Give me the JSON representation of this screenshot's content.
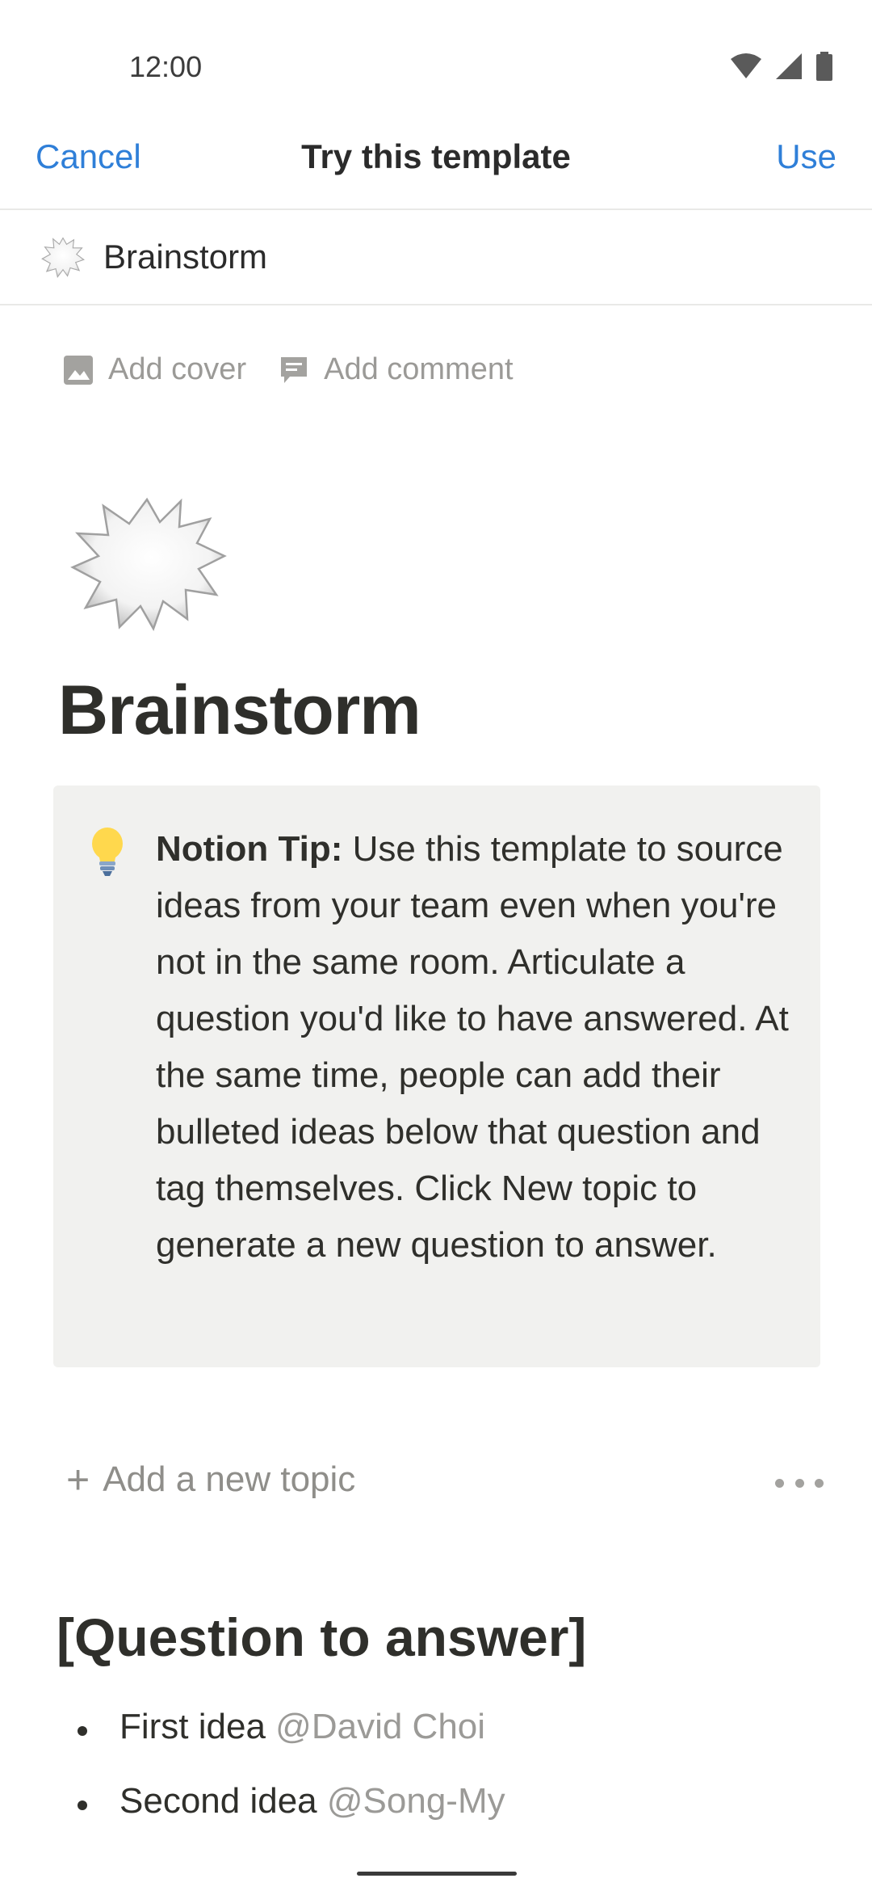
{
  "status_bar": {
    "time": "12:00"
  },
  "header": {
    "cancel": "Cancel",
    "title": "Try this template",
    "use": "Use"
  },
  "template": {
    "name": "Brainstorm"
  },
  "actions": {
    "add_cover": "Add cover",
    "add_comment": "Add comment"
  },
  "page": {
    "title": "Brainstorm"
  },
  "callout": {
    "bold_label": "Notion Tip:",
    "body": " Use this template to source ideas from your team even when you're not in the same room. Articulate a question you'd like to have answered. At the same time, people can add their bulleted ideas below that question and tag themselves. Click New topic to generate a new question to answer."
  },
  "add_topic": {
    "label": "Add a new topic"
  },
  "question": {
    "heading": "[Question to answer]"
  },
  "ideas": [
    {
      "text": "First idea",
      "mention": "@David Choi"
    },
    {
      "text": "Second idea",
      "mention": "@Song-My"
    }
  ],
  "icons": {
    "page_icon": "speech-burst-icon",
    "callout_icon": "light-bulb-icon",
    "cover": "image-icon",
    "comment": "comment-icon",
    "more": "more-icon"
  },
  "colors": {
    "accent": "#2f7fd8",
    "muted": "#9b9a97",
    "callout_bg": "#f1f1ef"
  }
}
